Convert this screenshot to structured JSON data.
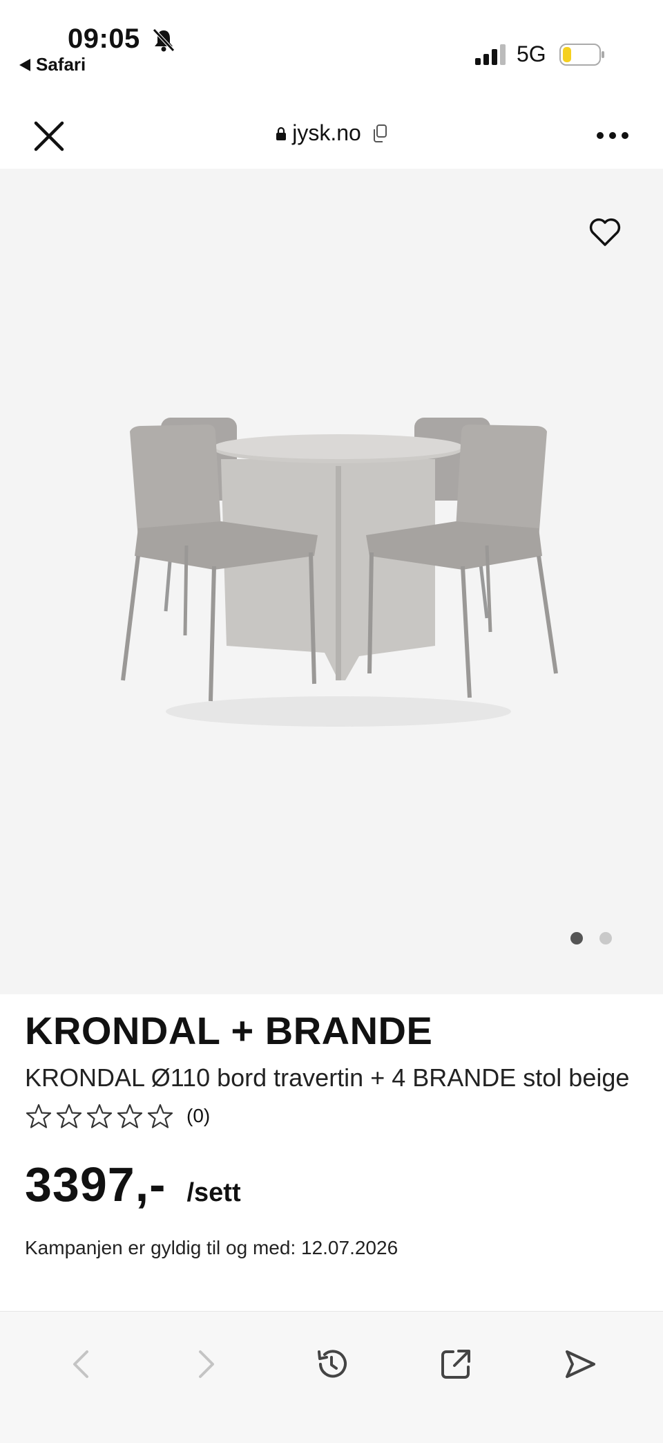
{
  "status_bar": {
    "time": "09:05",
    "back_app": "Safari",
    "network": "5G"
  },
  "browser": {
    "url": "jysk.no"
  },
  "gallery": {
    "dots": [
      "active",
      "inactive"
    ]
  },
  "product": {
    "title": "KRONDAL + BRANDE",
    "subtitle": "KRONDAL Ø110 bord travertin + 4 BRANDE stol beige",
    "rating_count": "(0)",
    "stars": 0,
    "price": "3397,-",
    "unit": "/sett",
    "campaign": "Kampanjen er gyldig til og med: 12.07.2026"
  },
  "icons": [
    "bell-muted-icon",
    "close-icon",
    "lock-icon",
    "copy-icon",
    "more-icon",
    "heart-icon",
    "back-icon",
    "forward-icon",
    "history-icon",
    "share-icon",
    "send-icon"
  ],
  "colors": {
    "gallery_bg": "#f4f4f4",
    "battery_level": "#f5d020"
  }
}
